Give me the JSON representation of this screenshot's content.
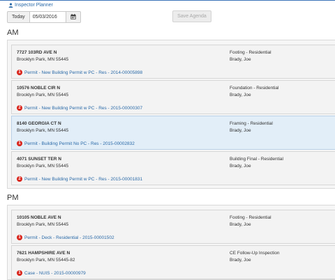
{
  "header": {
    "planner_link": "Inspector Planner"
  },
  "toolbar": {
    "today_label": "Today",
    "date_value": "05/03/2016",
    "save_label": "Save Agenda"
  },
  "sections": {
    "am": {
      "title": "AM",
      "items": [
        {
          "address": "7727 103RD AVE N",
          "city": "Brooklyn Park, MN 55445",
          "type": "Footing - Residential",
          "inspector": "Brady, Joe",
          "badge": "1",
          "record": "Permit - New Building Permit w PC - Res - 2014-00005898"
        },
        {
          "address": "10576 NOBLE CIR N",
          "city": "Brooklyn Park, MN 55445",
          "type": "Foundation - Residential",
          "inspector": "Brady, Joe",
          "badge": "2",
          "record": "Permit - New Building Permit w PC - Res - 2015-00000307"
        },
        {
          "address": "8140 GEORGIA CT N",
          "city": "Brooklyn Park, MN 55445",
          "type": "Framing - Residential",
          "inspector": "Brady, Joe",
          "badge": "1",
          "record": "Permit - Building Permit No PC - Res - 2015-00002832"
        },
        {
          "address": "4071 SUNSET TER N",
          "city": "Brooklyn Park, MN 55445",
          "type": "Building Final - Residential",
          "inspector": "Brady, Joe",
          "badge": "2",
          "record": "Permit - New Building Permit w PC - Res - 2015-00001831"
        }
      ]
    },
    "pm": {
      "title": "PM",
      "items": [
        {
          "address": "10105 NOBLE AVE N",
          "city": "Brooklyn Park, MN 55445",
          "type": "Footing - Residential",
          "inspector": "Brady, Joe",
          "badge": "1",
          "record": "Permit - Deck - Residential - 2015-00001502"
        },
        {
          "address": "7621 HAMPSHIRE AVE N",
          "city": "Brooklyn Park, MN 55445-82",
          "type": "CE Follow-Up Inspection",
          "inspector": "Brady, Joe",
          "badge": "1",
          "record": "Case - NUIS - 2015-00000979"
        }
      ]
    }
  },
  "colors": {
    "link": "#2a6aa8",
    "badge": "#d9251c",
    "highlight": "#e2eef8"
  },
  "icons": {
    "planner": "user-icon",
    "calendar": "calendar-icon"
  }
}
